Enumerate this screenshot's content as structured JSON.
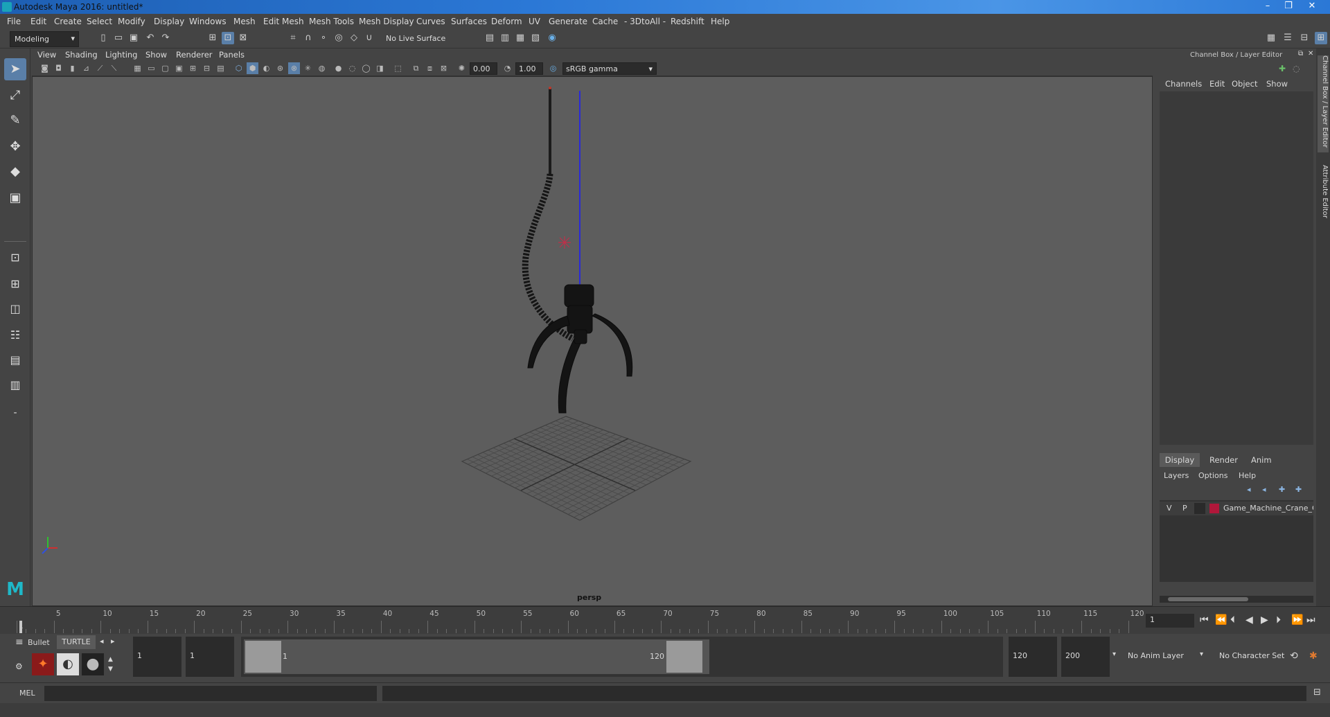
{
  "window": {
    "title": "Autodesk Maya 2016: untitled*",
    "minimize": "–",
    "restore": "❐",
    "close": "✕"
  },
  "menubar": [
    "File",
    "Edit",
    "Create",
    "Select",
    "Modify",
    "Display",
    "Windows",
    "Mesh",
    "Edit Mesh",
    "Mesh Tools",
    "Mesh Display",
    "Curves",
    "Surfaces",
    "Deform",
    "UV",
    "Generate",
    "Cache",
    "- 3DtoAll -",
    "Redshift",
    "Help"
  ],
  "status": {
    "mode": "Modeling",
    "live_surface": "No Live Surface"
  },
  "panel_menu": [
    "View",
    "Shading",
    "Lighting",
    "Show",
    "Renderer",
    "Panels"
  ],
  "panel_toolbar": {
    "exposure": "0.00",
    "gamma": "1.00",
    "colorspace": "sRGB gamma"
  },
  "viewport": {
    "camera_label": "persp"
  },
  "channel_box": {
    "header": "Channel Box / Layer Editor",
    "tabs": [
      "Channels",
      "Edit",
      "Object",
      "Show"
    ]
  },
  "layer_editor": {
    "tabs": [
      "Display",
      "Render",
      "Anim"
    ],
    "menu": [
      "Layers",
      "Options",
      "Help"
    ],
    "layer": {
      "v": "V",
      "p": "P",
      "name": "Game_Machine_Crane_C",
      "color": "#b0173a"
    }
  },
  "side_tabs": [
    "Channel Box / Layer Editor",
    "Attribute Editor"
  ],
  "timeline": {
    "ticks": [
      "1",
      "5",
      "10",
      "15",
      "20",
      "25",
      "30",
      "35",
      "40",
      "45",
      "50",
      "55",
      "60",
      "65",
      "70",
      "75",
      "80",
      "85",
      "90",
      "95",
      "100",
      "105",
      "110",
      "115",
      "120"
    ],
    "current_frame": "1"
  },
  "range": {
    "shelf_tabs": [
      "Bullet",
      "TURTLE"
    ],
    "start": "1",
    "playback_start": "1",
    "slider_start": "1",
    "slider_end": "120",
    "playback_end": "120",
    "end": "200",
    "anim_layer": "No Anim Layer",
    "character_set": "No Character Set"
  },
  "command_line": {
    "label": "MEL"
  },
  "icons": [
    "select-icon",
    "lasso-icon",
    "paint-icon",
    "move-icon",
    "rotate-icon",
    "scale-icon",
    "play-icon",
    "step-forward-icon",
    "step-back-icon",
    "key-icon",
    "close-icon"
  ]
}
